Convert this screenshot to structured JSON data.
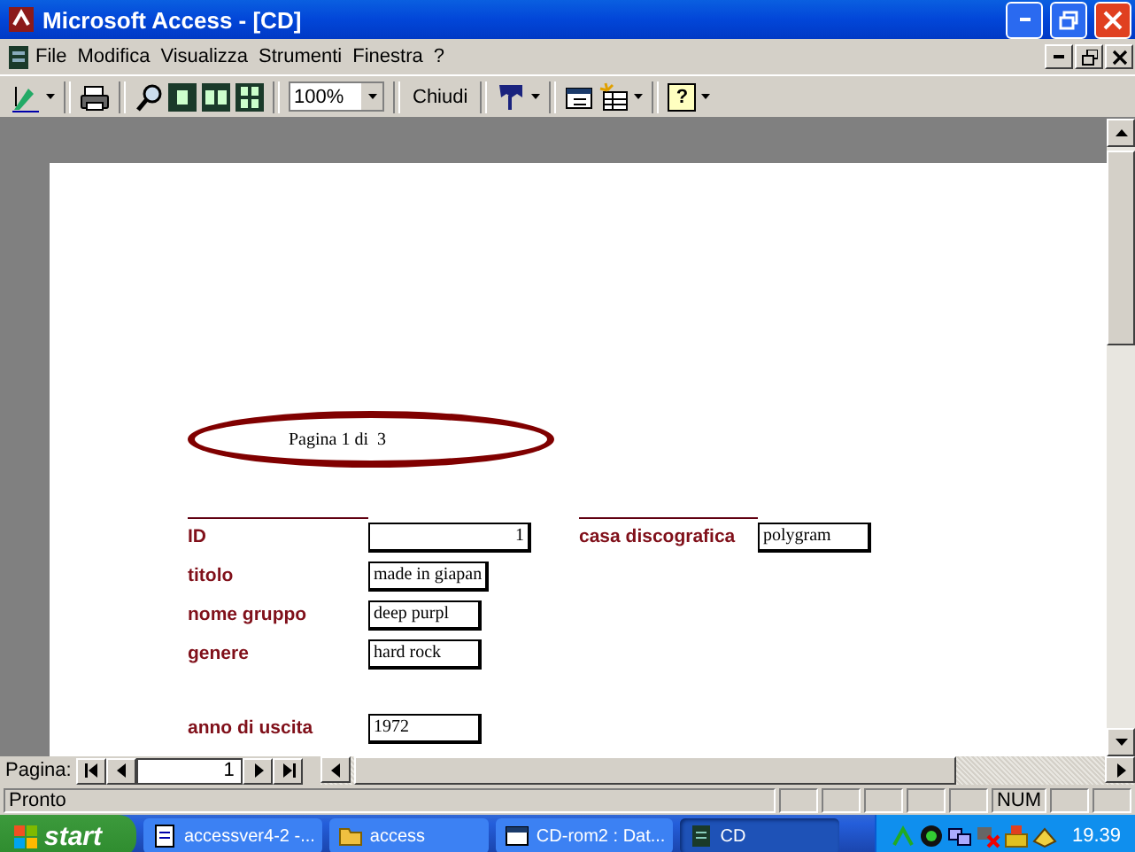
{
  "window": {
    "title": "Microsoft Access - [CD]"
  },
  "menu": [
    {
      "label": "File"
    },
    {
      "label": "Modifica"
    },
    {
      "label": "Visualizza"
    },
    {
      "label": "Strumenti"
    },
    {
      "label": "Finestra"
    },
    {
      "label": "?"
    }
  ],
  "toolbar": {
    "zoom": "100%",
    "close_button": "Chiudi",
    "help": "?"
  },
  "report": {
    "page_label": "Pagina 1 di  3",
    "fields": [
      {
        "label": "ID",
        "value": "1",
        "side_label": "casa discografica",
        "side_value": "polygram"
      },
      {
        "label": "titolo",
        "value": "made in giapan"
      },
      {
        "label": "nome gruppo",
        "value": "deep purpl"
      },
      {
        "label": "genere",
        "value": "hard rock"
      },
      {
        "label": "anno di uscita",
        "value": "1972"
      }
    ]
  },
  "navigation": {
    "label": "Pagina:",
    "page": "1"
  },
  "status_bar": {
    "text": "Pronto",
    "indicators": [
      "NUM"
    ]
  },
  "taskbar": {
    "start": "start",
    "tasks": [
      {
        "label": "accessver4-2 -...",
        "selected": false,
        "kind": "document"
      },
      {
        "label": "access",
        "selected": false,
        "kind": "folder"
      },
      {
        "label": "CD-rom2 : Dat...",
        "selected": false,
        "kind": "database"
      },
      {
        "label": "CD",
        "selected": true,
        "kind": "report"
      }
    ],
    "clock": "19.39"
  }
}
